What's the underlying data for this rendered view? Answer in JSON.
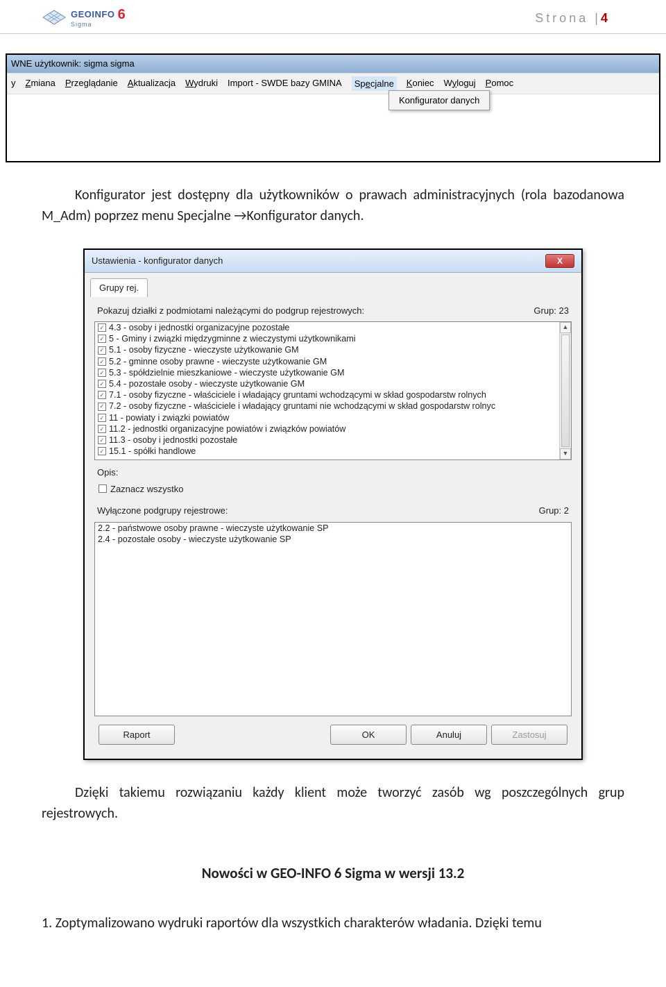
{
  "header": {
    "logo_text": "GEOINFO",
    "logo_sub": "Sigma",
    "logo_num": "6",
    "page_label": "Strona |",
    "page_num": "4"
  },
  "screenshot1": {
    "title": "WNE użytkownik: sigma sigma",
    "menu": {
      "zmiana": "Zmiana",
      "przegladanie": "Przeglądanie",
      "aktualizacja": "Aktualizacja",
      "wydruki": "Wydruki",
      "import": "Import - SWDE bazy GMINA",
      "specjalne": "Specjalne",
      "koniec": "Koniec",
      "wyloguj": "Wyloguj",
      "pomoc": "Pomoc"
    },
    "dropdown": "Konfigurator danych"
  },
  "para1": "Konfigurator jest dostępny dla użytkowników o prawach administracyjnych (rola bazodanowa M_Adm) poprzez menu Specjalne →Konfigurator danych.",
  "screenshot2": {
    "title": "Ustawienia - konfigurator danych",
    "tab": "Grupy rej.",
    "row1_label": "Pokazuj działki z podmiotami należącymi do podgrup rejestrowych:",
    "row1_count": "Grup: 23",
    "list1": [
      "4.3 - osoby i jednostki organizacyjne pozostałe",
      "5 - Gminy i związki międzygminne z wieczystymi użytkownikami",
      "5.1 - osoby fizyczne - wieczyste użytkowanie GM",
      "5.2 - gminne osoby prawne - wieczyste użytkowanie GM",
      "5.3 - spółdzielnie mieszkaniowe - wieczyste użytkowanie GM",
      "5.4 - pozostałe osoby - wieczyste użytkowanie GM",
      "7.1 - osoby fizyczne - właściciele i władający gruntami wchodzącymi w skład gospodarstw rolnych",
      "7.2 - osoby fizyczne - właściciele i władający gruntami nie wchodzącymi w skład gospodarstw rolnyc",
      "11 - powiaty i związki powiatów",
      "11.2 - jednostki organizacyjne powiatów i związków powiatów",
      "11.3 - osoby i jednostki pozostałe",
      "15.1 - spółki handlowe"
    ],
    "opis": "Opis:",
    "zaznacz": "Zaznacz wszystko",
    "row2_label": "Wyłączone podgrupy rejestrowe:",
    "row2_count": "Grup: 2",
    "list2": [
      "2.2 - państwowe osoby prawne - wieczyste użytkowanie SP",
      "2.4 - pozostałe osoby  - wieczyste użytkowanie SP"
    ],
    "buttons": {
      "raport": "Raport",
      "ok": "OK",
      "anuluj": "Anuluj",
      "zastosuj": "Zastosuj"
    }
  },
  "para2": "Dzięki takiemu rozwiązaniu każdy klient może tworzyć zasób wg poszczególnych grup rejestrowych.",
  "heading2": "Nowości w GEO-INFO 6 Sigma w wersji 13.2",
  "list_item1": "1.  Zoptymalizowano wydruki raportów dla wszystkich charakterów władania. Dzięki temu"
}
